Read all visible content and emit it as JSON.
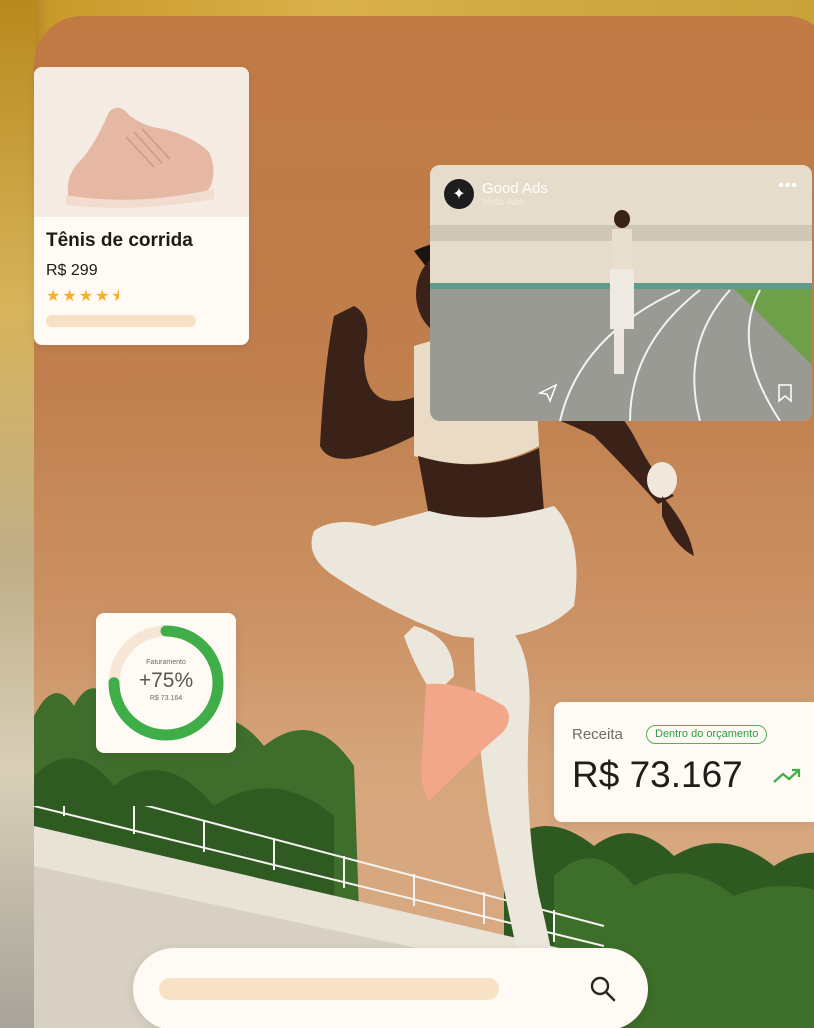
{
  "product": {
    "name": "Tênis de corrida",
    "price": "R$ 299",
    "rating": 4.5,
    "stars": "★★★★"
  },
  "ad": {
    "title": "Good Ads",
    "subtitle": "Meta Ads",
    "menu": "•••"
  },
  "ring": {
    "label": "Faturamento",
    "value": "+75%",
    "sub": "R$ 73.164",
    "progress": 0.75,
    "color": "#3fae49"
  },
  "revenue": {
    "label": "Receita",
    "badge": "Dentro do orçamento",
    "value": "R$ 73.167",
    "trend_icon": "trend-up-icon"
  },
  "search": {
    "icon": "search-icon"
  }
}
